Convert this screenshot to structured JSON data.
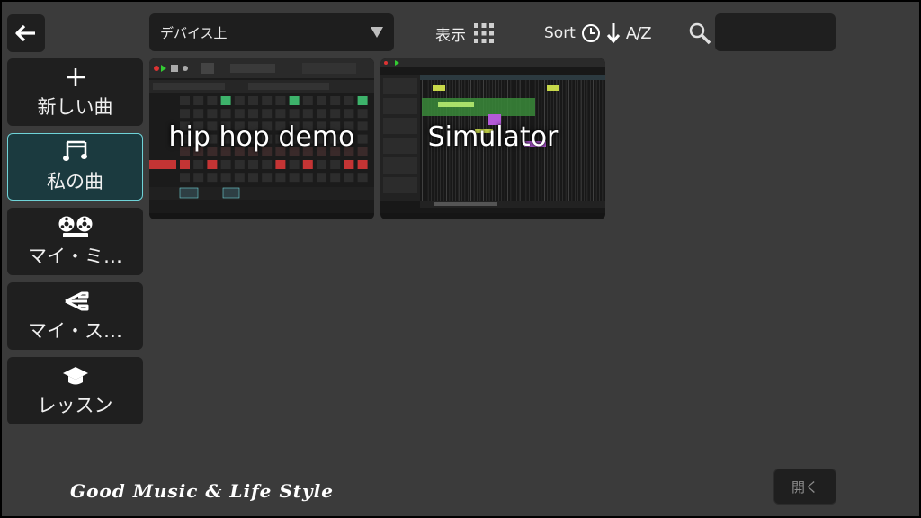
{
  "toolbar": {
    "location": "デバイス上",
    "view_label": "表示",
    "sort_label": "Sort",
    "sort_az": "A/Z",
    "search": {
      "value": "",
      "placeholder": ""
    }
  },
  "sidebar": {
    "items": [
      {
        "label": "新しい曲",
        "icon": "plus-icon"
      },
      {
        "label": "私の曲",
        "icon": "music-note-icon",
        "selected": true
      },
      {
        "label": "マイ・ミ…",
        "icon": "tape-reel-icon"
      },
      {
        "label": "マイ・ス…",
        "icon": "stack-icon"
      },
      {
        "label": "レッスン",
        "icon": "graduation-cap-icon"
      }
    ]
  },
  "songs": [
    {
      "title": "hip hop demo"
    },
    {
      "title": "Simulator"
    }
  ],
  "footer": {
    "tagline": "Good Music & Life Style",
    "open_label": "開く"
  },
  "colors": {
    "background": "#3b3b3b",
    "panel": "#1f1f1f",
    "accent": "#6fd3d8"
  }
}
